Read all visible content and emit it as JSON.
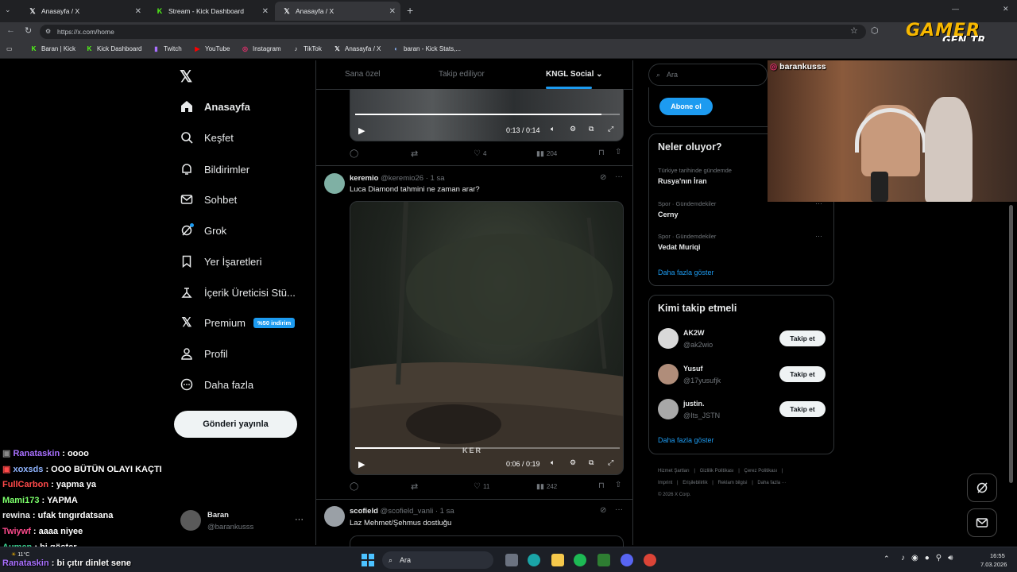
{
  "browser": {
    "tabs": [
      {
        "label": "Anasayfa / X",
        "icon": "x-logo-icon"
      },
      {
        "label": "Stream - Kick Dashboard",
        "icon": "kick-logo-icon"
      },
      {
        "label": "Anasayfa / X",
        "icon": "x-logo-icon"
      }
    ],
    "url": "https://x.com/home",
    "bookmarks": [
      "Baran | Kick",
      "Kick Dashboard",
      "Twitch",
      "YouTube",
      "Instagram",
      "TikTok",
      "Anasayfa / X",
      "baran - Kick Stats,..."
    ]
  },
  "watermark": {
    "line1": "GAMER",
    "line2": "GEN.TR"
  },
  "nav": {
    "items": [
      "Anasayfa",
      "Keşfet",
      "Bildirimler",
      "Sohbet",
      "Grok",
      "Yer İşaretleri",
      "İçerik Üreticisi Stü...",
      "Premium",
      "Profil",
      "Daha fazla"
    ],
    "premium_badge": "%50 indirim",
    "post_button": "Gönderi yayınla",
    "account": {
      "name": "Baran",
      "handle": "@barankusss",
      "more": "···"
    }
  },
  "timeline_tabs": [
    "Sana özel",
    "Takip ediliyor",
    "KNGL Social"
  ],
  "tweets": [
    {
      "video_time": "0:13 / 0:14",
      "progress": 0.93,
      "replies": "",
      "retweets": "",
      "likes": "4",
      "views": "204"
    },
    {
      "name": "keremio",
      "handle": "@keremio26",
      "time": "· 1 sa",
      "text": "Luca Diamond tahmini ne zaman arar?",
      "video_time": "0:06 / 0:19",
      "progress": 0.32,
      "video_watermark": "KER",
      "replies": "",
      "retweets": "",
      "likes": "11",
      "views": "242"
    },
    {
      "name": "scofield",
      "handle": "@scofield_vanli",
      "time": "· 1 sa",
      "text": "Laz Mehmet/Şehmus dostluğu"
    }
  ],
  "sidebar": {
    "search_placeholder": "Ara",
    "subscribe": "Abone ol",
    "trends_title": "Neler oluyor?",
    "trends": [
      {
        "category": "Türkiye tarihinde gündemde",
        "name": "Rusya'nın İran"
      },
      {
        "category": "Spor · Gündemdekiler",
        "name": "Cerny"
      },
      {
        "category": "Spor · Gündemdekiler",
        "name": "Vedat Muriqi"
      }
    ],
    "show_more": "Daha fazla göster",
    "who_title": "Kimi takip etmeli",
    "who": [
      {
        "name": "AK2W",
        "handle": "@ak2wio"
      },
      {
        "name": "Yusuf",
        "handle": "@17yusufjk"
      },
      {
        "name": "justin.",
        "handle": "@Its_JSTN"
      }
    ],
    "follow_label": "Takip et",
    "footer": [
      "Hizmet Şartları",
      "|",
      "Gizlilik Politikası",
      "|",
      "Çerez Politikası",
      "|",
      "Imprint",
      "|",
      "Erişilebilirlik",
      "|",
      "Reklam bilgisi",
      "|",
      "Daha fazla ···",
      "© 2026 X Corp."
    ]
  },
  "webcam": {
    "username": "barankusss"
  },
  "chat": [
    {
      "user": "Ranataskin",
      "msg": ": oooo",
      "color": "#a970ff"
    },
    {
      "user": "xoxsds",
      "msg": ": OOO BÜTÜN OLAYI KAÇTI",
      "color": "#8fb4ff"
    },
    {
      "user": "FullCarbon",
      "msg": ": yapma ya",
      "color": "#ff4a4a"
    },
    {
      "user": "Mami173",
      "msg": ": YAPMA",
      "color": "#7cff6b"
    },
    {
      "user": "rewina",
      "msg": ": ufak tıngırdatsana",
      "color": "#e7e9ea"
    },
    {
      "user": "Twiywf",
      "msg": ": aaaa niyee",
      "color": "#ff4a8d"
    },
    {
      "user": "Aumen",
      "msg": ": bi göster",
      "color": "#3ddc97"
    },
    {
      "user": "Ranataskin",
      "msg": ": bi çıtır dinlet sene",
      "color": "#a970ff"
    }
  ],
  "taskbar": {
    "search": "Ara",
    "weather": "11°C",
    "time": "16:55",
    "date": "7.03.2026"
  }
}
